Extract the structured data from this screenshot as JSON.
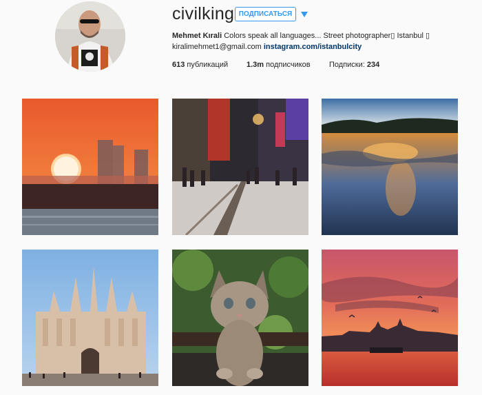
{
  "profile": {
    "username": "civilking",
    "follow_label": "ПОДПИСАТЬСЯ",
    "dropdown_icon": "caret-down-icon",
    "full_name": "Mehmet Kırali",
    "bio_text": " Colors speak all languages... Street photographer▯ Istanbul ▯",
    "email": "kiralimehmet1@gmail.com",
    "website": "instagram.com/istanbulcity",
    "stats": {
      "posts_count": "613",
      "posts_label": " публикаций",
      "followers_count": "1.3m",
      "followers_label": " подписчиков",
      "following_label": "Подписки: ",
      "following_count": "234"
    }
  },
  "colors": {
    "accent": "#3897f0",
    "link": "#003569",
    "background": "#fafafa"
  },
  "posts": [
    {
      "subject": "sunset-city-skyline"
    },
    {
      "subject": "snowy-night-street"
    },
    {
      "subject": "sunset-lake-reflection"
    },
    {
      "subject": "milan-cathedral"
    },
    {
      "subject": "tabby-kitten"
    },
    {
      "subject": "istanbul-sunset-seagulls"
    }
  ]
}
